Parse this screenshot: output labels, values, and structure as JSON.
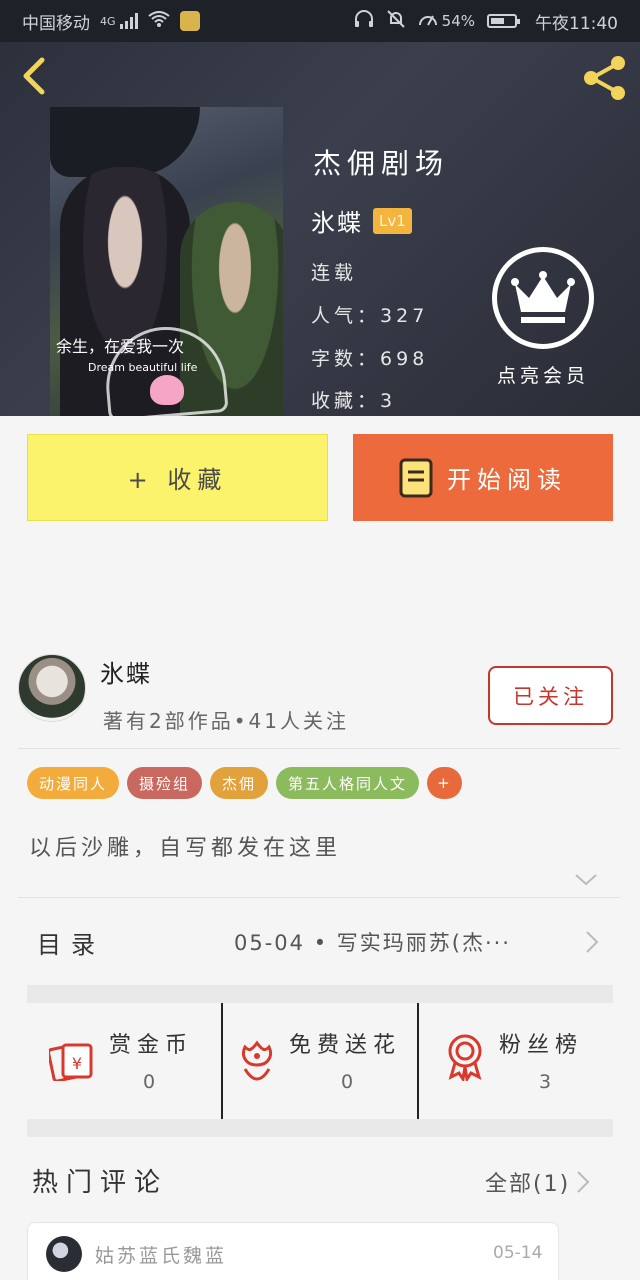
{
  "status_bar": {
    "carrier": "中国移动",
    "network": "4G",
    "battery_pct": "54%",
    "time": "午夜11:40"
  },
  "book": {
    "title": "杰佣剧场",
    "author": "氷蝶",
    "level": "Lv1",
    "status": "连载",
    "popularity_label": "人气：",
    "popularity": "327",
    "word_count_label": "字数：",
    "word_count": "698",
    "favorites_label": "收藏：",
    "favorites": "3",
    "cover_text_1": "余生，在爱我一次",
    "cover_text_2": "Dream beautiful life"
  },
  "vip": {
    "label": "点亮会员"
  },
  "actions": {
    "collect_label": "+ 收藏",
    "read_label": "开始阅读"
  },
  "author_info": {
    "name": "氷蝶",
    "stats": "著有2部作品•41人关注",
    "follow_label": "已关注"
  },
  "tags": [
    {
      "label": "动漫同人",
      "color": "#f3ac3b"
    },
    {
      "label": "摄殓组",
      "color": "#c8685e"
    },
    {
      "label": "杰佣",
      "color": "#e2a23b"
    },
    {
      "label": "第五人格同人文",
      "color": "#8bbb5c"
    },
    {
      "label": "+",
      "color": "#e86a3c"
    }
  ],
  "description": "以后沙雕，自写都发在这里",
  "toc": {
    "label": "目录",
    "latest": "05-04 • 写实玛丽苏(杰···"
  },
  "stats": [
    {
      "label": "赏金币",
      "value": "0",
      "icon": "red-envelope-icon"
    },
    {
      "label": "免费送花",
      "value": "0",
      "icon": "flower-icon"
    },
    {
      "label": "粉丝榜",
      "value": "3",
      "icon": "medal-icon"
    }
  ],
  "comments": {
    "title": "热门评论",
    "all_label": "全部(1)",
    "items": [
      {
        "user": "姑苏蓝氏魏蓝",
        "date": "05-14"
      }
    ]
  },
  "colors": {
    "accent_orange": "#ec6a3b",
    "collect_yellow": "#fbf36c",
    "follow_red": "#c4372c",
    "icon_red": "#d9382c",
    "lv_badge": "#f3b53e"
  }
}
